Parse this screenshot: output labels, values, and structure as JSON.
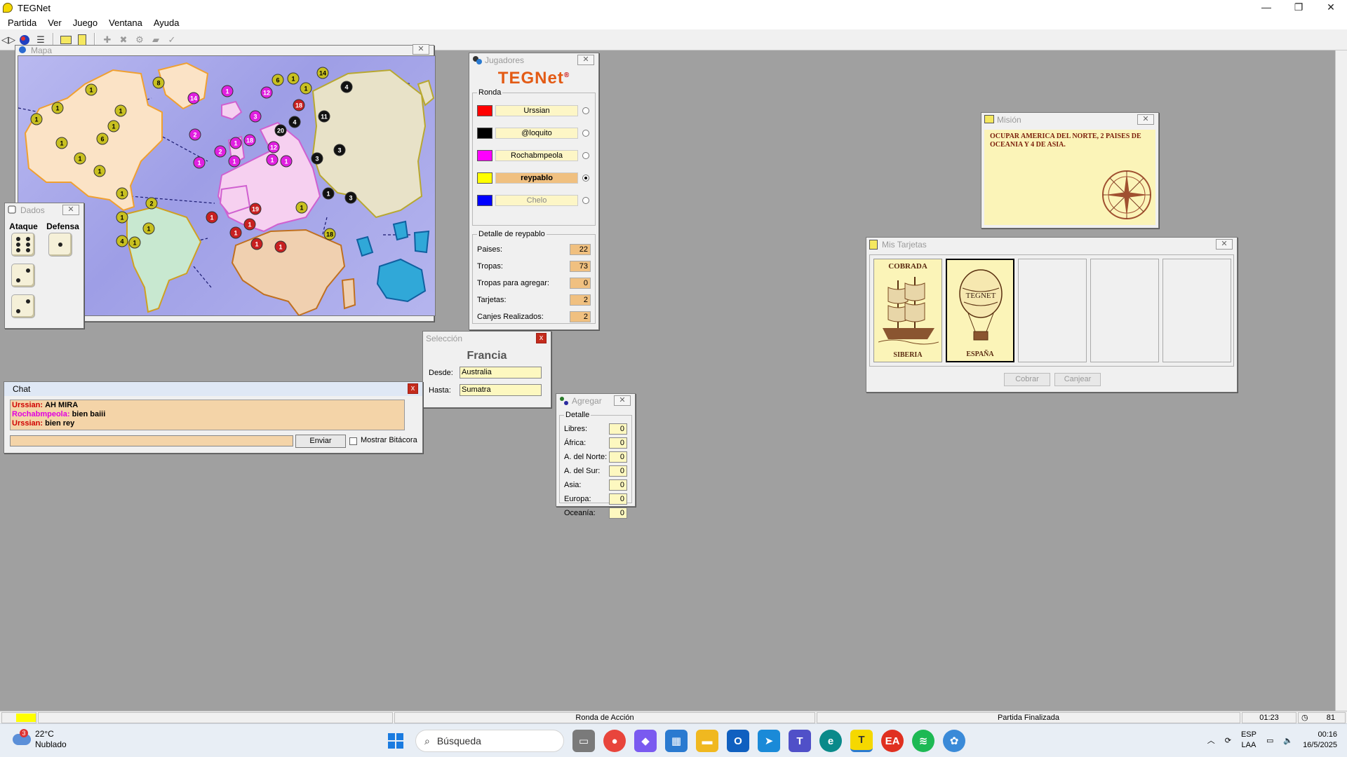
{
  "window": {
    "title": "TEGNet",
    "controls": [
      "—",
      "❐",
      "✕"
    ]
  },
  "menu": [
    "Partida",
    "Ver",
    "Juego",
    "Ventana",
    "Ayuda"
  ],
  "map_window": {
    "title": "Mapa",
    "armies": [
      {
        "n": "1",
        "c": "#c8c020",
        "t": "#000"
      },
      {
        "n": "8",
        "c": "#c8c020",
        "t": "#000"
      },
      {
        "n": "1",
        "c": "#c8c020",
        "t": "#000"
      },
      {
        "n": "1",
        "c": "#c8c020",
        "t": "#000"
      },
      {
        "n": "1",
        "c": "#c8c020",
        "t": "#000"
      },
      {
        "n": "1",
        "c": "#c8c020",
        "t": "#000"
      },
      {
        "n": "6",
        "c": "#c8c020",
        "t": "#000"
      },
      {
        "n": "1",
        "c": "#c8c020",
        "t": "#000"
      },
      {
        "n": "1",
        "c": "#c8c020",
        "t": "#000"
      },
      {
        "n": "1",
        "c": "#c8c020",
        "t": "#000"
      },
      {
        "n": "1",
        "c": "#c8c020",
        "t": "#000"
      },
      {
        "n": "2",
        "c": "#c8c020",
        "t": "#000"
      },
      {
        "n": "1",
        "c": "#c8c020",
        "t": "#000"
      },
      {
        "n": "1",
        "c": "#c8c020",
        "t": "#000"
      },
      {
        "n": "4",
        "c": "#c8c020",
        "t": "#000"
      },
      {
        "n": "1",
        "c": "#c8c020",
        "t": "#000"
      },
      {
        "n": "14",
        "c": "#e020e0",
        "t": "#fff"
      },
      {
        "n": "1",
        "c": "#e020e0",
        "t": "#fff"
      },
      {
        "n": "2",
        "c": "#e020e0",
        "t": "#fff"
      },
      {
        "n": "3",
        "c": "#e020e0",
        "t": "#fff"
      },
      {
        "n": "1",
        "c": "#e020e0",
        "t": "#fff"
      },
      {
        "n": "18",
        "c": "#e020e0",
        "t": "#fff"
      },
      {
        "n": "1",
        "c": "#e020e0",
        "t": "#fff"
      },
      {
        "n": "2",
        "c": "#e020e0",
        "t": "#fff"
      },
      {
        "n": "1",
        "c": "#e020e0",
        "t": "#fff"
      },
      {
        "n": "12",
        "c": "#e020e0",
        "t": "#fff"
      },
      {
        "n": "12",
        "c": "#e020e0",
        "t": "#fff"
      },
      {
        "n": "1",
        "c": "#e020e0",
        "t": "#fff"
      },
      {
        "n": "1",
        "c": "#e020e0",
        "t": "#fff"
      },
      {
        "n": "6",
        "c": "#c8c020",
        "t": "#000"
      },
      {
        "n": "1",
        "c": "#c8c020",
        "t": "#000"
      },
      {
        "n": "14",
        "c": "#c8c020",
        "t": "#000"
      },
      {
        "n": "1",
        "c": "#c8c020",
        "t": "#000"
      },
      {
        "n": "18",
        "c": "#c82020",
        "t": "#fff"
      },
      {
        "n": "4",
        "c": "#111",
        "t": "#fff"
      },
      {
        "n": "11",
        "c": "#111",
        "t": "#fff"
      },
      {
        "n": "20",
        "c": "#111",
        "t": "#fff"
      },
      {
        "n": "4",
        "c": "#111",
        "t": "#fff"
      },
      {
        "n": "3",
        "c": "#111",
        "t": "#fff"
      },
      {
        "n": "3",
        "c": "#111",
        "t": "#fff"
      },
      {
        "n": "19",
        "c": "#c82020",
        "t": "#fff"
      },
      {
        "n": "1",
        "c": "#c82020",
        "t": "#fff"
      },
      {
        "n": "1",
        "c": "#c82020",
        "t": "#fff"
      },
      {
        "n": "1",
        "c": "#c82020",
        "t": "#fff"
      },
      {
        "n": "1",
        "c": "#c82020",
        "t": "#fff"
      },
      {
        "n": "1",
        "c": "#c82020",
        "t": "#fff"
      },
      {
        "n": "1",
        "c": "#c8c020",
        "t": "#000"
      },
      {
        "n": "1",
        "c": "#111",
        "t": "#fff"
      },
      {
        "n": "3",
        "c": "#111",
        "t": "#fff"
      },
      {
        "n": "18",
        "c": "#c8c020",
        "t": "#000"
      }
    ]
  },
  "dice_window": {
    "title": "Dados",
    "attack_label": "Ataque",
    "defense_label": "Defensa"
  },
  "players_window": {
    "title": "Jugadores",
    "logo_a": "TEG",
    "logo_b": "Net",
    "logo_mark": "®",
    "round_label": "Ronda",
    "players": [
      {
        "name": "Urssian",
        "color": "#ff0000",
        "state": "normal",
        "turn": false
      },
      {
        "name": "@loquito",
        "color": "#000000",
        "state": "normal",
        "turn": false
      },
      {
        "name": "Rochabmpeola",
        "color": "#ff00ff",
        "state": "normal",
        "turn": false
      },
      {
        "name": "reypablo",
        "color": "#ffff00",
        "state": "current",
        "turn": true
      },
      {
        "name": "Chelo",
        "color": "#0000ff",
        "state": "dim",
        "turn": false
      }
    ],
    "detail_label": "Detalle de reypablo",
    "stats": [
      {
        "label": "Paises:",
        "value": "22"
      },
      {
        "label": "Tropas:",
        "value": "73"
      },
      {
        "label": "Tropas para agregar:",
        "value": "0"
      },
      {
        "label": "Tarjetas:",
        "value": "2"
      },
      {
        "label": "Canjes Realizados:",
        "value": "2"
      }
    ]
  },
  "selection_window": {
    "title": "Selección",
    "country": "Francia",
    "from_label": "Desde:",
    "from_value": "Australia",
    "to_label": "Hasta:",
    "to_value": "Sumatra"
  },
  "chat_window": {
    "title": "Chat",
    "messages": [
      {
        "user": "Urssian:",
        "text": "AH MIRA",
        "color": "#d00000"
      },
      {
        "user": "Rochabmpeola:",
        "text": "bien baiii",
        "color": "#e000e0"
      },
      {
        "user": "Urssian:",
        "text": "bien rey",
        "color": "#d00000"
      }
    ],
    "send_label": "Enviar",
    "log_label": "Mostrar Bitácora"
  },
  "add_window": {
    "title": "Agregar",
    "detail_label": "Detalle",
    "rows": [
      {
        "label": "Libres:",
        "value": "0"
      },
      {
        "label": "África:",
        "value": "0"
      },
      {
        "label": "A. del Norte:",
        "value": "0"
      },
      {
        "label": "A. del Sur:",
        "value": "0"
      },
      {
        "label": "Asia:",
        "value": "0"
      },
      {
        "label": "Europa:",
        "value": "0"
      },
      {
        "label": "Oceanía:",
        "value": "0"
      }
    ]
  },
  "mission_window": {
    "title": "Misión",
    "text": "OCUPAR AMERICA DEL NORTE, 2 PAISES DE OCEANIA Y 4 DE ASIA."
  },
  "cards_window": {
    "title": "Mis Tarjetas",
    "cards": [
      {
        "top": "COBRADA",
        "bottom": "SIBERIA",
        "art": "ship-icon",
        "selected": false
      },
      {
        "top": "",
        "bottom": "ESPAÑA",
        "art": "balloon-icon",
        "selected": true,
        "balloon_text": "TEGNET"
      }
    ],
    "empty_slots": 3,
    "collect_label": "Cobrar",
    "exchange_label": "Canjear"
  },
  "status_bar": {
    "round": "Ronda de Acción",
    "game": "Partida Finalizada",
    "time": "01:23",
    "count": "81"
  },
  "taskbar": {
    "temp": "22°C",
    "weather": "Nublado",
    "weather_badge": "3",
    "search_placeholder": "Búsqueda",
    "lang1": "ESP",
    "lang2": "LAA",
    "time": "00:16",
    "date": "16/5/2025"
  }
}
